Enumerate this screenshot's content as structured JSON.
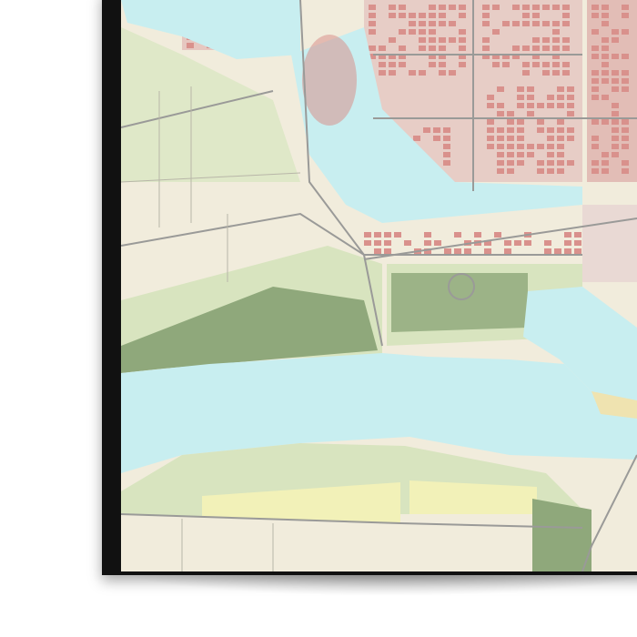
{
  "poster": {
    "type": "framed city map print",
    "colors": {
      "water": "#c8eef0",
      "land": "#f1ecdc",
      "green": "#d8e4bf",
      "dark_green": "#8fa87b",
      "urban": "#d9918c",
      "road": "#9a9a98",
      "orchard": "#f2f1b8",
      "frame": "#111111"
    }
  }
}
